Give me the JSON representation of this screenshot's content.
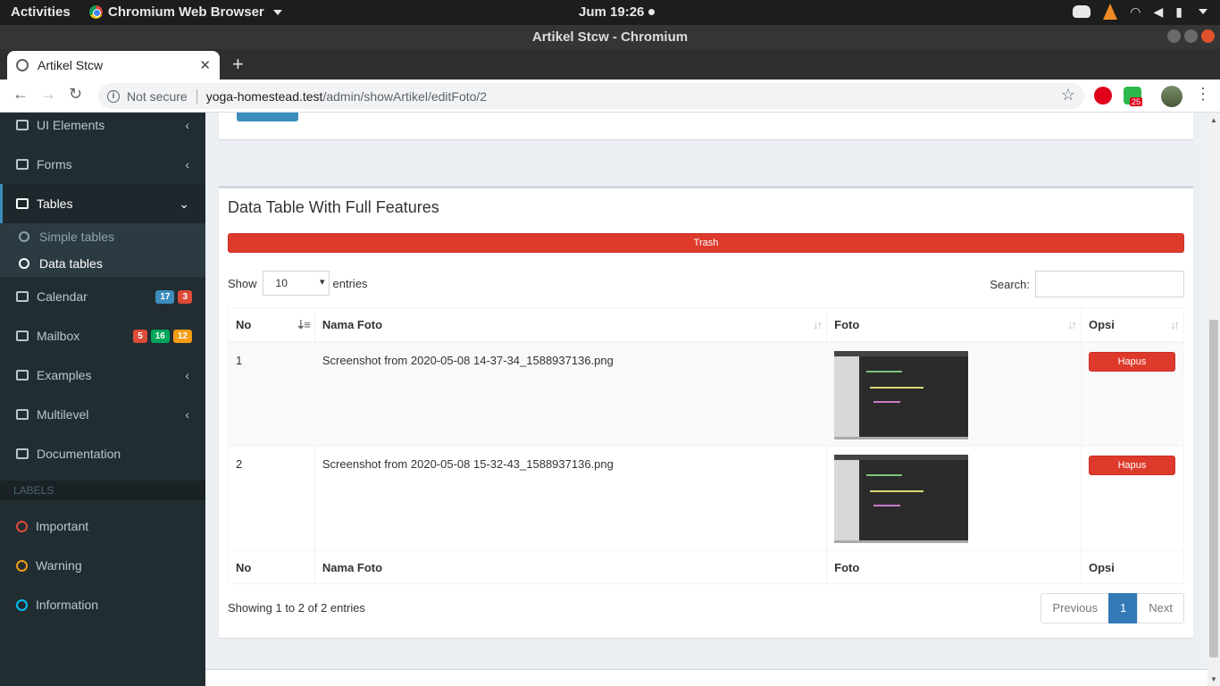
{
  "os": {
    "activities": "Activities",
    "app_name": "Chromium Web Browser",
    "clock": "Jum 19:26"
  },
  "window": {
    "title": "Artikel Stcw - Chromium"
  },
  "tab": {
    "title": "Artikel Stcw",
    "close": "✕",
    "new": "+"
  },
  "omnibox": {
    "security": "Not secure",
    "host": "yoga-homestead.test",
    "path": "/admin/showArtikel/editFoto/2",
    "ext_badge": "25"
  },
  "sidebar": {
    "items": [
      {
        "label": "UI Elements"
      },
      {
        "label": "Forms"
      },
      {
        "label": "Tables"
      },
      {
        "label": "Calendar",
        "badges": [
          "17",
          "3"
        ]
      },
      {
        "label": "Mailbox",
        "badges": [
          "5",
          "16",
          "12"
        ]
      },
      {
        "label": "Examples"
      },
      {
        "label": "Multilevel"
      },
      {
        "label": "Documentation"
      }
    ],
    "subitems": [
      {
        "label": "Simple tables"
      },
      {
        "label": "Data tables"
      }
    ],
    "header": "LABELS",
    "labels": [
      {
        "label": "Important",
        "color": "#dd4b39"
      },
      {
        "label": "Warning",
        "color": "#f39c12"
      },
      {
        "label": "Information",
        "color": "#00c0ef"
      }
    ]
  },
  "box": {
    "title": "Data Table With Full Features",
    "trash_label": "Trash",
    "show_label": "Show",
    "entries_value": "10",
    "entries_label": "entries",
    "search_label": "Search:",
    "columns": [
      "No",
      "Nama Foto",
      "Foto",
      "Opsi"
    ],
    "rows": [
      {
        "no": "1",
        "name": "Screenshot from 2020-05-08 14-37-34_1588937136.png",
        "action": "Hapus"
      },
      {
        "no": "2",
        "name": "Screenshot from 2020-05-08 15-32-43_1588937136.png",
        "action": "Hapus"
      }
    ],
    "info": "Showing 1 to 2 of 2 entries",
    "pagination": {
      "previous": "Previous",
      "page": "1",
      "next": "Next"
    }
  },
  "colors": {
    "sidebar_bg": "#222d32",
    "danger": "#dd3a2c",
    "primary": "#337ab7"
  }
}
